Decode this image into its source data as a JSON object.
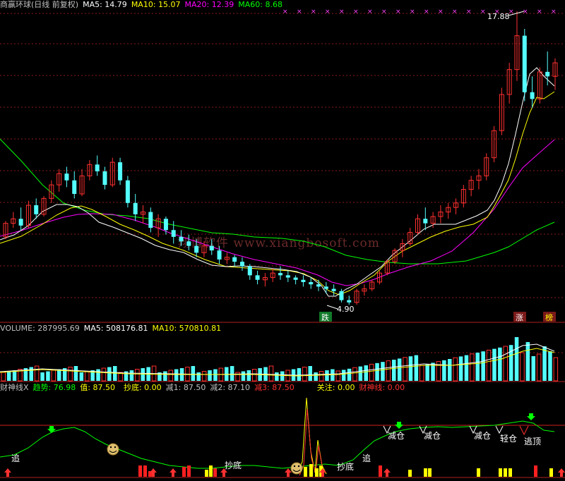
{
  "price_panel": {
    "stock_title": "商赢环球(日线 前复权)",
    "ma5": "MA5: 14.79",
    "ma10": "MA10: 15.07",
    "ma20": "MA20: 12.39",
    "ma60": "MA60: 8.68",
    "high_label": "17.88",
    "low_label": "4.90",
    "signal_die": "跌",
    "signal_zhang": "涨",
    "signal_bang": "榜"
  },
  "volume_panel": {
    "volume": "VOLUME: 287995.69",
    "ma5": "MA5: 508176.81",
    "ma10": "MA10: 570810.81"
  },
  "indicator_panel": {
    "name": "财神线X",
    "trend": "趋势: 76.98",
    "value": "值: 87.50",
    "chaodi": "抄底: 0.00",
    "jian1": "减1: 87.50",
    "jian2": "减2: 87.10",
    "jian3": "减3: 87.50",
    "guanzhu": "关注: 0.00",
    "caishen": "财神线: 0.00",
    "labels": {
      "zhui1": "追",
      "chaodi1": "抄底",
      "chaodi2": "抄底",
      "zhui2": "追",
      "jiancang1": "减仓",
      "jiancang2": "减仓",
      "jiancang3": "减仓",
      "qingcang": "轻仓",
      "taoding": "逃顶"
    }
  },
  "watermark": "翔博软件 www.xiangbosoft.com",
  "colors": {
    "background": "#000000",
    "grid": "#8b1a1a",
    "up_candle": "#ff3030",
    "down_candle": "#54ffff",
    "ma5": "#ffffff",
    "ma10": "#ffff00",
    "ma20": "#ff00ff",
    "ma60": "#00ff00"
  },
  "chart_data": [
    {
      "type": "candlestick",
      "title": "商赢环球(日线 前复权)",
      "series": [
        {
          "name": "MA5",
          "last": 14.79
        },
        {
          "name": "MA10",
          "last": 15.07
        },
        {
          "name": "MA20",
          "last": 12.39
        },
        {
          "name": "MA60",
          "last": 8.68
        }
      ],
      "annotations": {
        "high": 17.88,
        "low": 4.9
      },
      "ohlc": [
        [
          7.9,
          8.6,
          7.8,
          8.5
        ],
        [
          8.5,
          9.0,
          8.3,
          8.7
        ],
        [
          8.7,
          9.2,
          8.2,
          8.4
        ],
        [
          8.4,
          9.5,
          8.3,
          9.3
        ],
        [
          9.3,
          9.6,
          8.7,
          8.9
        ],
        [
          8.9,
          9.7,
          8.8,
          9.6
        ],
        [
          9.6,
          10.4,
          9.4,
          10.2
        ],
        [
          10.2,
          10.9,
          9.9,
          10.7
        ],
        [
          10.7,
          11.0,
          10.1,
          10.4
        ],
        [
          10.4,
          10.8,
          9.6,
          9.8
        ],
        [
          9.8,
          10.9,
          9.7,
          10.6
        ],
        [
          10.6,
          11.3,
          10.4,
          11.1
        ],
        [
          11.1,
          11.5,
          10.6,
          10.8
        ],
        [
          10.8,
          11.0,
          10.0,
          10.2
        ],
        [
          10.2,
          11.4,
          10.1,
          11.2
        ],
        [
          11.2,
          11.4,
          10.2,
          10.4
        ],
        [
          10.4,
          10.6,
          9.2,
          9.4
        ],
        [
          9.4,
          9.8,
          8.6,
          8.9
        ],
        [
          8.9,
          9.3,
          8.5,
          9.0
        ],
        [
          9.0,
          9.2,
          8.1,
          8.3
        ],
        [
          8.3,
          8.9,
          7.9,
          8.7
        ],
        [
          8.7,
          8.8,
          8.0,
          8.2
        ],
        [
          8.2,
          8.6,
          7.6,
          7.9
        ],
        [
          7.9,
          8.2,
          7.5,
          7.7
        ],
        [
          7.7,
          8.0,
          7.3,
          7.5
        ],
        [
          7.5,
          7.8,
          7.0,
          7.2
        ],
        [
          7.2,
          7.7,
          7.0,
          7.5
        ],
        [
          7.5,
          7.8,
          7.1,
          7.3
        ],
        [
          7.3,
          7.5,
          6.7,
          6.9
        ],
        [
          6.9,
          7.2,
          6.7,
          7.0
        ],
        [
          7.0,
          7.1,
          6.6,
          6.8
        ],
        [
          6.8,
          7.0,
          6.4,
          6.6
        ],
        [
          6.6,
          6.7,
          6.0,
          6.2
        ],
        [
          6.2,
          6.4,
          5.8,
          6.0
        ],
        [
          6.0,
          6.3,
          5.7,
          6.1
        ],
        [
          6.1,
          6.5,
          5.9,
          6.3
        ],
        [
          6.3,
          6.6,
          6.0,
          6.2
        ],
        [
          6.2,
          6.4,
          5.9,
          6.1
        ],
        [
          6.1,
          6.2,
          5.8,
          6.0
        ],
        [
          6.0,
          6.2,
          5.7,
          5.9
        ],
        [
          5.9,
          6.1,
          5.6,
          5.8
        ],
        [
          5.8,
          6.0,
          5.5,
          5.7
        ],
        [
          5.7,
          5.9,
          5.4,
          5.6
        ],
        [
          5.6,
          5.8,
          5.3,
          5.5
        ],
        [
          5.5,
          5.6,
          5.0,
          5.1
        ],
        [
          5.1,
          5.3,
          4.9,
          5.0
        ],
        [
          5.0,
          5.6,
          4.9,
          5.5
        ],
        [
          5.5,
          5.8,
          5.3,
          5.6
        ],
        [
          5.6,
          6.0,
          5.5,
          5.9
        ],
        [
          5.9,
          6.4,
          5.8,
          6.3
        ],
        [
          6.3,
          6.9,
          6.2,
          6.8
        ],
        [
          6.8,
          7.4,
          6.7,
          7.3
        ],
        [
          7.3,
          7.8,
          7.0,
          7.6
        ],
        [
          7.6,
          8.3,
          7.5,
          8.1
        ],
        [
          8.1,
          8.9,
          8.0,
          8.7
        ],
        [
          8.7,
          9.2,
          8.2,
          8.5
        ],
        [
          8.5,
          9.0,
          8.3,
          8.8
        ],
        [
          8.8,
          9.3,
          8.5,
          9.0
        ],
        [
          9.0,
          9.4,
          8.7,
          9.2
        ],
        [
          9.2,
          9.6,
          8.9,
          9.4
        ],
        [
          9.4,
          10.2,
          9.2,
          10.0
        ],
        [
          10.0,
          10.6,
          9.7,
          10.4
        ],
        [
          10.4,
          10.9,
          10.0,
          10.6
        ],
        [
          10.6,
          11.6,
          10.4,
          11.4
        ],
        [
          11.4,
          12.8,
          11.2,
          12.6
        ],
        [
          12.6,
          14.5,
          12.4,
          14.2
        ],
        [
          14.2,
          15.6,
          13.8,
          15.3
        ],
        [
          15.3,
          17.88,
          14.8,
          16.8
        ],
        [
          16.8,
          17.1,
          13.9,
          14.3
        ],
        [
          14.3,
          15.0,
          13.6,
          14.0
        ],
        [
          14.0,
          15.4,
          13.8,
          15.2
        ],
        [
          15.2,
          16.1,
          14.6,
          15.0
        ],
        [
          15.0,
          15.8,
          14.4,
          15.6
        ]
      ]
    }
  ]
}
